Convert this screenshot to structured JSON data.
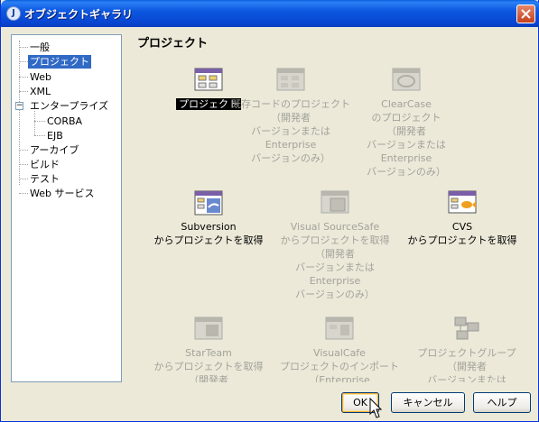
{
  "window": {
    "title": "オブジェクトギャラリ",
    "app_icon": "J"
  },
  "tree": {
    "items": [
      {
        "label": "一般",
        "level": 0,
        "selected": false
      },
      {
        "label": "プロジェクト",
        "level": 0,
        "selected": true
      },
      {
        "label": "Web",
        "level": 0,
        "selected": false
      },
      {
        "label": "XML",
        "level": 0,
        "selected": false
      },
      {
        "label": "エンタープライズ",
        "level": 0,
        "selected": false,
        "expanded": true
      },
      {
        "label": "CORBA",
        "level": 1,
        "selected": false
      },
      {
        "label": "EJB",
        "level": 1,
        "selected": false
      },
      {
        "label": "アーカイブ",
        "level": 0,
        "selected": false
      },
      {
        "label": "ビルド",
        "level": 0,
        "selected": false
      },
      {
        "label": "テスト",
        "level": 0,
        "selected": false
      },
      {
        "label": "Web サービス",
        "level": 0,
        "selected": false
      }
    ],
    "expander_symbol": "−"
  },
  "section_title": "プロジェクト",
  "gallery": [
    {
      "label": "プロジェクト",
      "disabled": false,
      "highlight": true,
      "icon": "project-icon"
    },
    {
      "label": "既存コードのプロジェクト\n（開発者\nバージョンまたは\nEnterprise\nバージョンのみ）",
      "disabled": true,
      "highlight": false,
      "icon": "existing-code-project-icon"
    },
    {
      "label": "ClearCase\nのプロジェクト\n（開発者\nバージョンまたは\nEnterprise\nバージョンのみ）",
      "disabled": true,
      "highlight": false,
      "icon": "clearcase-icon"
    },
    {
      "label": "Subversion\nからプロジェクトを取得",
      "disabled": false,
      "highlight": false,
      "icon": "subversion-icon"
    },
    {
      "label": "Visual SourceSafe\nからプロジェクトを取得\n（開発者\nバージョンまたは\nEnterprise\nバージョンのみ）",
      "disabled": true,
      "highlight": false,
      "icon": "sourcesafe-icon"
    },
    {
      "label": "CVS\nからプロジェクトを取得",
      "disabled": false,
      "highlight": false,
      "icon": "cvs-icon"
    },
    {
      "label": "StarTeam\nからプロジェクトを取得\n（開発者",
      "disabled": true,
      "highlight": false,
      "icon": "starteam-icon"
    },
    {
      "label": "VisualCafe\nプロジェクトのインポート\n（Enterprise",
      "disabled": true,
      "highlight": false,
      "icon": "visualcafe-icon"
    },
    {
      "label": "プロジェクトグループ\n（開発者\nバージョンまたは",
      "disabled": true,
      "highlight": false,
      "icon": "project-group-icon"
    }
  ],
  "buttons": {
    "ok": "OK",
    "cancel": "キャンセル",
    "help": "ヘルプ"
  },
  "colors": {
    "selection": "#316ac5",
    "titlebar": "#0845d0",
    "disabled_text": "#a3a29b"
  }
}
